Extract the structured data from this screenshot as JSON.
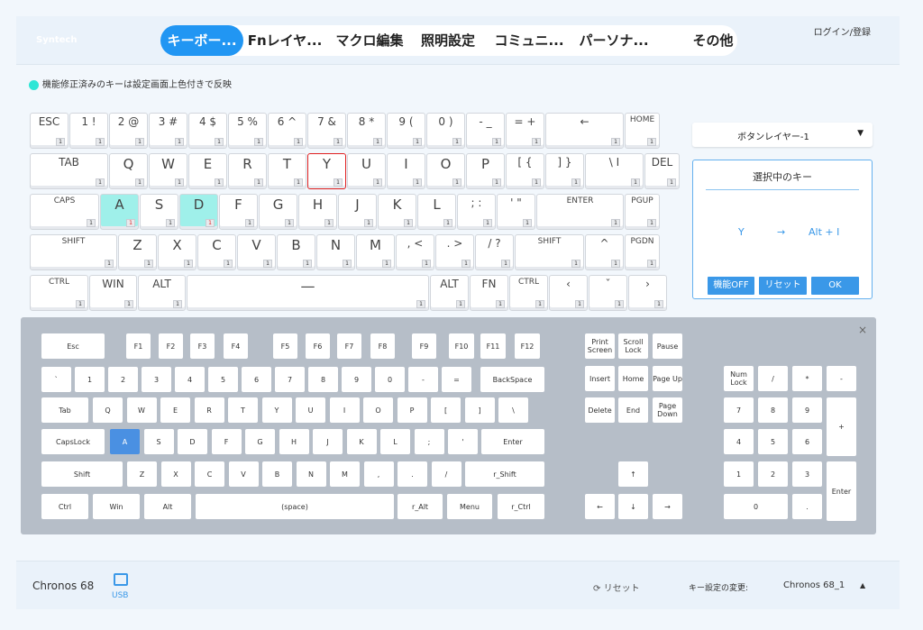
{
  "app": {
    "logo": "Syntech",
    "login": "ログイン/登録"
  },
  "tabs": [
    {
      "label": "キーボー...",
      "active": true
    },
    {
      "label": "Fnレイヤ...",
      "active": false
    },
    {
      "label": "マクロ編集",
      "active": false
    },
    {
      "label": "照明設定",
      "active": false
    },
    {
      "label": "コミュニ...",
      "active": false
    },
    {
      "label": "パーソナ...",
      "active": false
    },
    {
      "label": "その他",
      "active": false
    }
  ],
  "notice": {
    "text": "機能修正済みのキーは設定画面上色付きで反映",
    "color": "#2ee6d6"
  },
  "keyboard": {
    "layer_badge": "1",
    "highlight_color": "#9ff0ea",
    "rows": [
      [
        "ESC",
        "1 !",
        "2 @",
        "3 #",
        "4 $",
        "5 %",
        "6 ^",
        "7 &",
        "8 *",
        "9 (",
        "0 )",
        "- _",
        "= +",
        "←",
        "HOME"
      ],
      [
        "TAB",
        "Q",
        "W",
        "E",
        "R",
        "T",
        "Y",
        "U",
        "I",
        "O",
        "P",
        "[ {",
        "] }",
        "\\ I",
        "DEL"
      ],
      [
        "CAPS",
        "A",
        "S",
        "D",
        "F",
        "G",
        "H",
        "J",
        "K",
        "L",
        "; :",
        "' \"",
        "ENTER",
        "PGUP"
      ],
      [
        "SHIFT",
        "Z",
        "X",
        "C",
        "V",
        "B",
        "N",
        "M",
        ", <",
        ". >",
        "/ ?",
        "SHIFT",
        "^",
        "PGDN"
      ],
      [
        "CTRL",
        "WIN",
        "ALT",
        "—",
        "ALT",
        "FN",
        "CTRL",
        "‹",
        "ˇ",
        "›"
      ]
    ]
  },
  "layer_select": {
    "value": "ボタンレイヤー-1"
  },
  "selection_panel": {
    "title": "選択中のキー",
    "from_key": "Y",
    "arrow": "→",
    "to_key": "Alt + I",
    "buttons": {
      "off": "機能OFF",
      "reset": "リセット",
      "ok": "OK"
    }
  },
  "virtual_keyboard": {
    "close": "×",
    "active_color": "#4a90e2",
    "main_rows": [
      [
        "Esc",
        "F1",
        "F2",
        "F3",
        "F4",
        "F5",
        "F6",
        "F7",
        "F8",
        "F9",
        "F10",
        "F11",
        "F12"
      ],
      [
        "`",
        "1",
        "2",
        "3",
        "4",
        "5",
        "6",
        "7",
        "8",
        "9",
        "0",
        "-",
        "=",
        "BackSpace"
      ],
      [
        "Tab",
        "Q",
        "W",
        "E",
        "R",
        "T",
        "Y",
        "U",
        "I",
        "O",
        "P",
        "[",
        "]",
        "\\"
      ],
      [
        "CapsLock",
        "A",
        "S",
        "D",
        "F",
        "G",
        "H",
        "J",
        "K",
        "L",
        ";",
        "'",
        "Enter"
      ],
      [
        "Shift",
        "Z",
        "X",
        "C",
        "V",
        "B",
        "N",
        "M",
        ",",
        ".",
        "/",
        "r_Shift"
      ],
      [
        "Ctrl",
        "Win",
        "Alt",
        "(space)",
        "r_Alt",
        "Menu",
        "r_Ctrl"
      ]
    ],
    "nav": [
      "Print Screen",
      "Scroll Lock",
      "Pause",
      "Insert",
      "Home",
      "Page Up",
      "Delete",
      "End",
      "Page Down",
      "↑",
      "←",
      "↓",
      "→"
    ],
    "numpad": [
      "Num Lock",
      "/",
      "*",
      "-",
      "7",
      "8",
      "9",
      "+",
      "4",
      "5",
      "6",
      "1",
      "2",
      "3",
      "Enter",
      "0",
      "."
    ]
  },
  "footer": {
    "device": "Chronos 68",
    "connection": "USB",
    "reset": "リセット",
    "key_change_label": "キー設定の変更:",
    "profile": "Chronos 68_1",
    "caret": "▲"
  }
}
